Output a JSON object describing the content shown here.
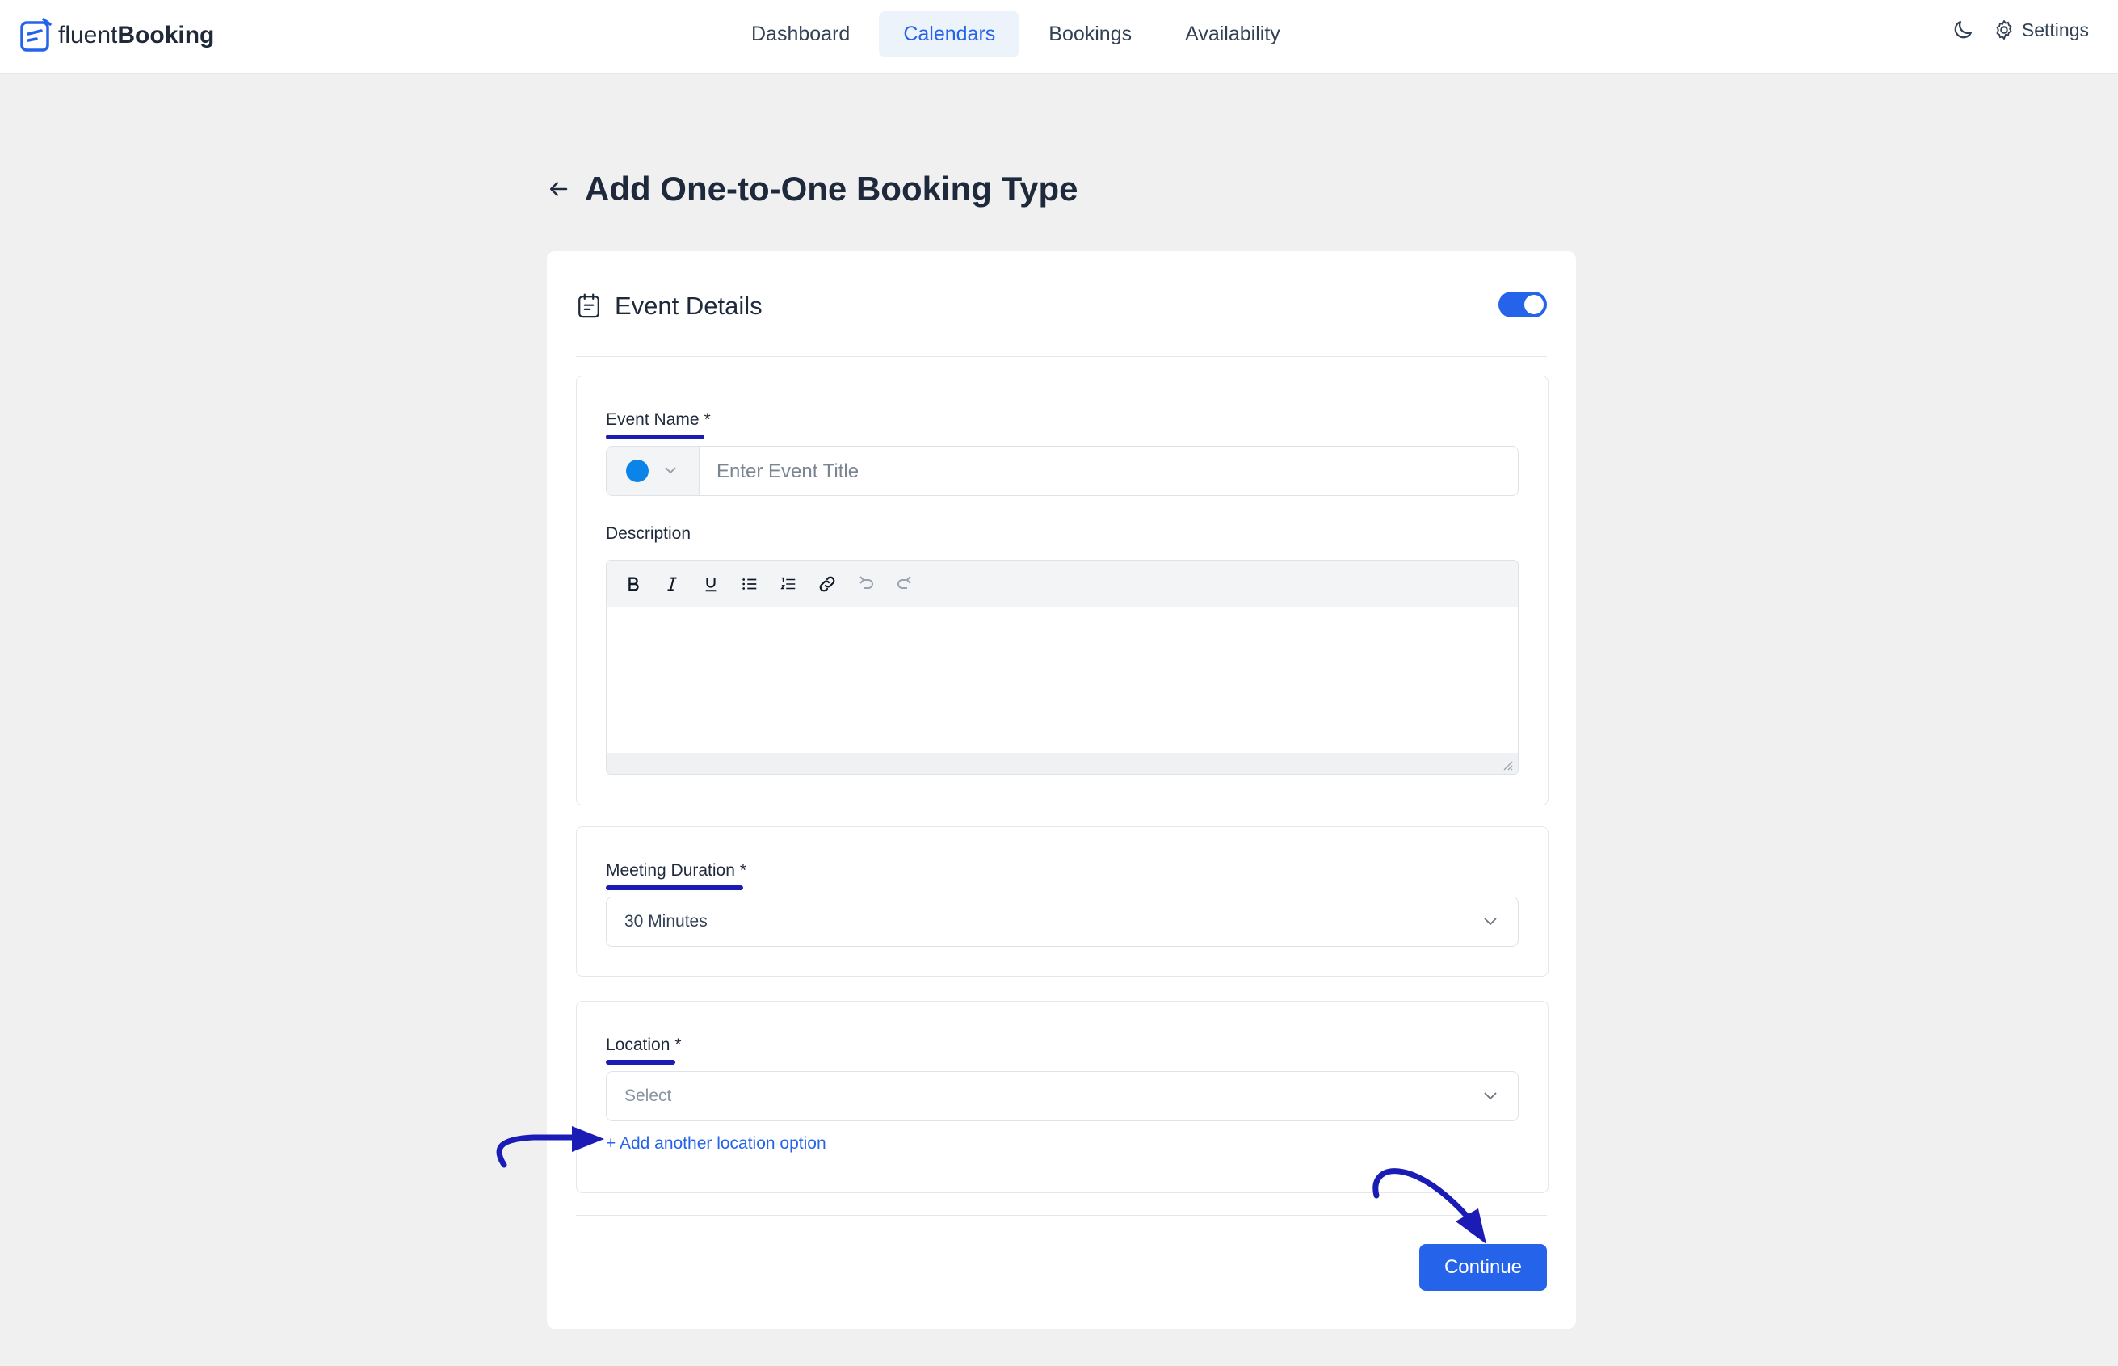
{
  "app": {
    "brand_light": "fluent",
    "brand_bold": "Booking"
  },
  "nav": {
    "items": [
      {
        "label": "Dashboard"
      },
      {
        "label": "Calendars"
      },
      {
        "label": "Bookings"
      },
      {
        "label": "Availability"
      }
    ],
    "active": "Calendars",
    "settings_label": "Settings"
  },
  "page": {
    "title": "Add One-to-One Booking Type"
  },
  "card": {
    "header": "Event Details",
    "toggle_on": true,
    "event_name": {
      "label": "Event Name",
      "required_mark": "*",
      "placeholder": "Enter Event Title",
      "color": "#0a84e8"
    },
    "description": {
      "label": "Description",
      "toolbar": [
        "bold-icon",
        "italic-icon",
        "underline-icon",
        "bullet-list-icon",
        "numbered-list-icon",
        "link-icon",
        "undo-icon",
        "redo-icon"
      ]
    },
    "duration": {
      "label": "Meeting Duration",
      "required_mark": "*",
      "value": "30 Minutes"
    },
    "location": {
      "label": "Location",
      "required_mark": "*",
      "placeholder": "Select",
      "add_link": "+ Add another location option"
    },
    "continue_label": "Continue"
  },
  "colors": {
    "accent": "#2563eb",
    "annotation": "#1b1bb5",
    "background": "#f0f0f1"
  }
}
